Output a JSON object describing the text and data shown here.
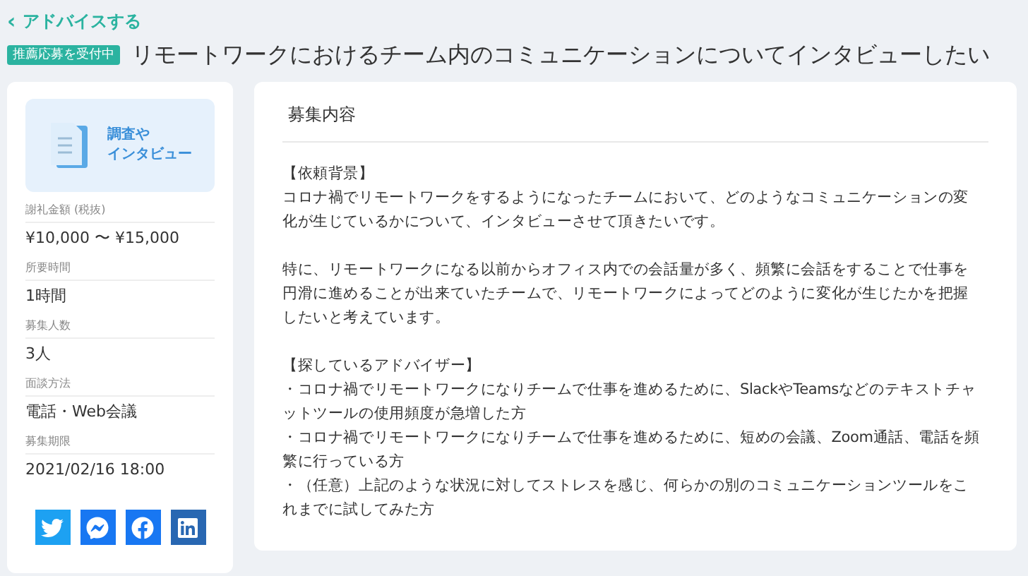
{
  "back_link": {
    "icon": "‹",
    "label": "アドバイスする"
  },
  "status_badge": "推薦応募を受付中",
  "title": "リモートワークにおけるチーム内のコミュニケーションについてインタビューしたい",
  "category": {
    "label_lines": [
      "調査や",
      "インタビュー"
    ]
  },
  "details": [
    {
      "label": "謝礼金額 (税抜)",
      "value": "¥10,000 〜 ¥15,000"
    },
    {
      "label": "所要時間",
      "value": "1時間"
    },
    {
      "label": "募集人数",
      "value": "3人"
    },
    {
      "label": "面談方法",
      "value": "電話・Web会議"
    },
    {
      "label": "募集期限",
      "value": "2021/02/16 18:00"
    }
  ],
  "share_buttons": [
    {
      "kind": "twitter"
    },
    {
      "kind": "messenger"
    },
    {
      "kind": "facebook"
    },
    {
      "kind": "linkedin"
    }
  ],
  "content": {
    "heading": "募集内容",
    "blocks": [
      {
        "lines": [
          "【依頼背景】",
          "コロナ禍でリモートワークをするようになったチームにおいて、どのようなコミュニケーションの変化が生じているかについて、インタビューさせて頂きたいです。"
        ]
      },
      {
        "lines": [
          "特に、リモートワークになる以前からオフィス内での会話量が多く、頻繁に会話をすることで仕事を円滑に進めることが出来ていたチームで、リモートワークによってどのように変化が生じたかを把握したいと考えています。"
        ]
      },
      {
        "lines": [
          "【探しているアドバイザー】",
          "・コロナ禍でリモートワークになりチームで仕事を進めるために、SlackやTeamsなどのテキストチャットツールの使用頻度が急増した方",
          "・コロナ禍でリモートワークになりチームで仕事を進めるために、短めの会議、Zoom通話、電話を頻繁に行っている方",
          "・（任意）上記のような状況に対してストレスを感じ、何らかの別のコミュニケーションツールをこれまでに試してみた方"
        ]
      }
    ]
  }
}
